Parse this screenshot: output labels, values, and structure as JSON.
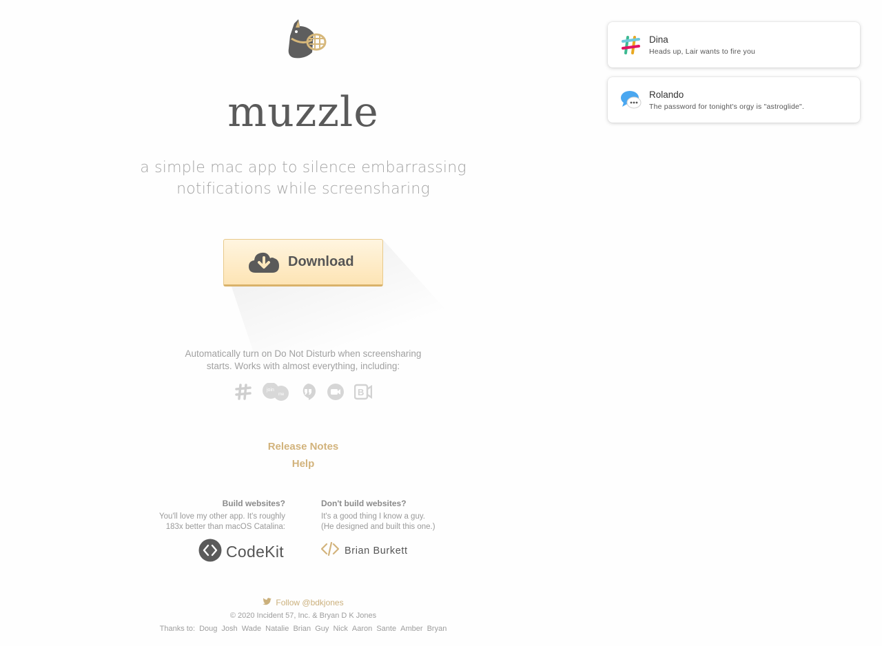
{
  "hero": {
    "logo_icon": "muzzled-dog-icon",
    "title": "muzzle",
    "tagline": "a simple mac app to silence embarrassing notifications while screensharing"
  },
  "download": {
    "icon": "cloud-download-icon",
    "label": "Download"
  },
  "features": {
    "text": "Automatically turn on Do Not Disturb when screensharing starts. Works with almost everything, including:",
    "apps": [
      "slack-icon",
      "join-me-icon",
      "hangouts-icon",
      "zoom-icon",
      "bluejeans-icon"
    ]
  },
  "links": {
    "release_notes": "Release Notes",
    "help": "Help"
  },
  "promo": {
    "left_heading": "Build websites?",
    "left_line1": "You'll love my other app. It's roughly",
    "left_line2": "183x better than macOS Catalina:",
    "codekit_label": "CodeKit",
    "right_heading": "Don't build websites?",
    "right_line1": "It's a good thing I know a guy.",
    "right_line2": "(He designed and built this one.)",
    "brian_label": "Brian Burkett"
  },
  "footer": {
    "follow": "Follow @bdkjones",
    "copyright": "© 2020 Incident 57, Inc. & Bryan D K Jones",
    "thanks_label": "Thanks to:",
    "thanks_names": [
      "Doug",
      "Josh",
      "Wade",
      "Natalie",
      "Brian",
      "Guy",
      "Nick",
      "Aaron",
      "Sante",
      "Amber",
      "Bryan"
    ]
  },
  "notifications": [
    {
      "app_icon": "slack-icon",
      "name": "Dina",
      "body": "Heads up, Lair wants to fire you"
    },
    {
      "app_icon": "messages-icon",
      "name": "Rolando",
      "body": "The password for tonight's orgy is \"astroglide\"."
    }
  ],
  "colors": {
    "accent_gold": "#d2b37c",
    "button_top": "#fff5e0",
    "button_bottom": "#fde4b4",
    "title_gray": "#5a5a5a"
  }
}
